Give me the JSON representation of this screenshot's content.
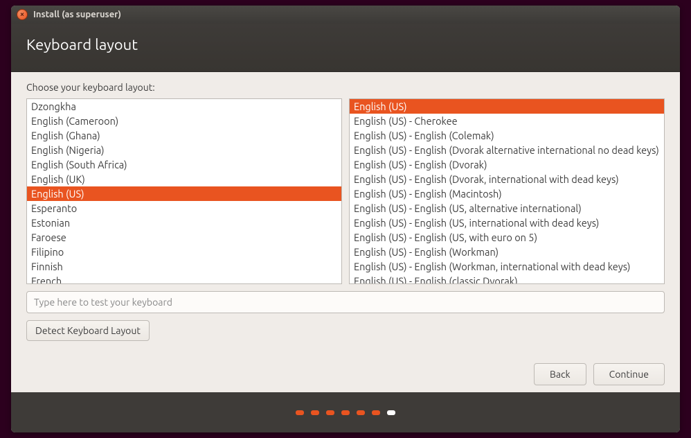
{
  "titlebar": {
    "close_label": "×",
    "title": "Install (as superuser)"
  },
  "header": {
    "title": "Keyboard layout"
  },
  "instruction": "Choose your keyboard layout:",
  "layouts": {
    "items": [
      {
        "label": "Dzongkha",
        "selected": false
      },
      {
        "label": "English (Cameroon)",
        "selected": false
      },
      {
        "label": "English (Ghana)",
        "selected": false
      },
      {
        "label": "English (Nigeria)",
        "selected": false
      },
      {
        "label": "English (South Africa)",
        "selected": false
      },
      {
        "label": "English (UK)",
        "selected": false
      },
      {
        "label": "English (US)",
        "selected": true
      },
      {
        "label": "Esperanto",
        "selected": false
      },
      {
        "label": "Estonian",
        "selected": false
      },
      {
        "label": "Faroese",
        "selected": false
      },
      {
        "label": "Filipino",
        "selected": false
      },
      {
        "label": "Finnish",
        "selected": false
      },
      {
        "label": "French",
        "selected": false
      }
    ]
  },
  "variants": {
    "items": [
      {
        "label": "English (US)",
        "selected": true
      },
      {
        "label": "English (US) - Cherokee",
        "selected": false
      },
      {
        "label": "English (US) - English (Colemak)",
        "selected": false
      },
      {
        "label": "English (US) - English (Dvorak alternative international no dead keys)",
        "selected": false
      },
      {
        "label": "English (US) - English (Dvorak)",
        "selected": false
      },
      {
        "label": "English (US) - English (Dvorak, international with dead keys)",
        "selected": false
      },
      {
        "label": "English (US) - English (Macintosh)",
        "selected": false
      },
      {
        "label": "English (US) - English (US, alternative international)",
        "selected": false
      },
      {
        "label": "English (US) - English (US, international with dead keys)",
        "selected": false
      },
      {
        "label": "English (US) - English (US, with euro on 5)",
        "selected": false
      },
      {
        "label": "English (US) - English (Workman)",
        "selected": false
      },
      {
        "label": "English (US) - English (Workman, international with dead keys)",
        "selected": false
      },
      {
        "label": "English (US) - English (classic Dvorak)",
        "selected": false
      }
    ]
  },
  "test_input": {
    "placeholder": "Type here to test your keyboard",
    "value": ""
  },
  "buttons": {
    "detect": "Detect Keyboard Layout",
    "back": "Back",
    "continue": "Continue"
  },
  "progress": {
    "total": 7,
    "current": 7
  }
}
